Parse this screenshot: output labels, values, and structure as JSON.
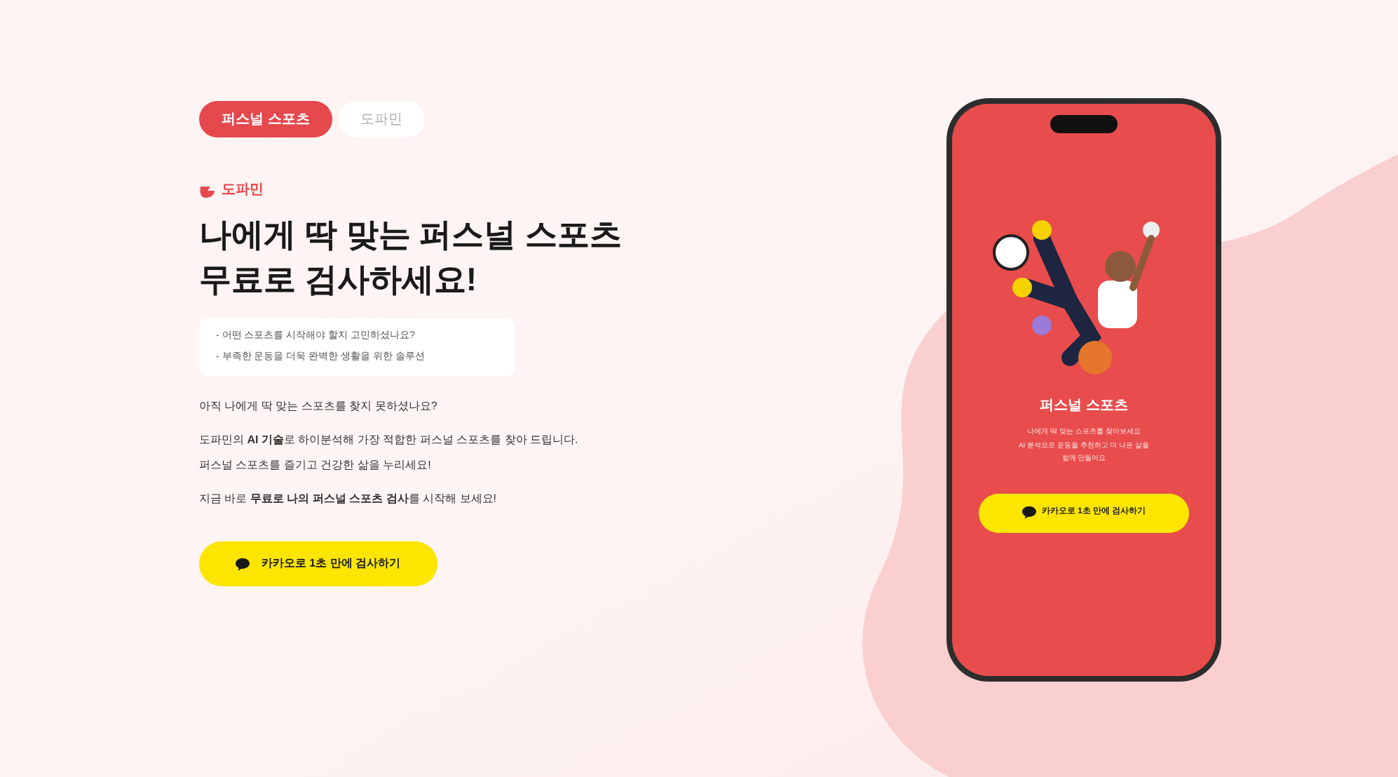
{
  "tabs": [
    {
      "label": "퍼스널 스포츠",
      "selected": true
    },
    {
      "label": "도파민",
      "selected": false
    }
  ],
  "brand": "도파민",
  "headline": [
    "나에게 딱 맞는 **퍼스널 스포츠**",
    "무료로 검사하세요!"
  ],
  "bullets": [
    "- 어떤 스포츠를 시작해야 할지 고민하셨나요?",
    "- 부족한 운동을 더욱 완벽한 생활을 위한 솔루션"
  ],
  "paragraphs": [
    [
      "아직 나에게 딱 맞는 스포츠를 찾지 못하셨나요?"
    ],
    [
      "도파민의 **AI 기술**로 하이분석해 가장 적합한 퍼스널 스포츠를 찾아 드립니다.",
      "퍼스널 스포츠를 즐기고 건강한 삶을 누리세요!"
    ],
    [
      "지금 바로 **무료로 나의 퍼스널 스포츠 검사**를 시작해 보세요!"
    ]
  ],
  "cta": {
    "label": "카카오로 1초 만에 검사하기"
  },
  "phone": {
    "title": "퍼스널 스포츠",
    "lines": [
      "나에게 딱 맞는 스포츠를 찾아보세요",
      "AI 분석으로 운동을 추천하고 더 나은 삶을",
      "함께 만들어요"
    ],
    "cta": "카카오로 1초 만에 검사하기"
  }
}
